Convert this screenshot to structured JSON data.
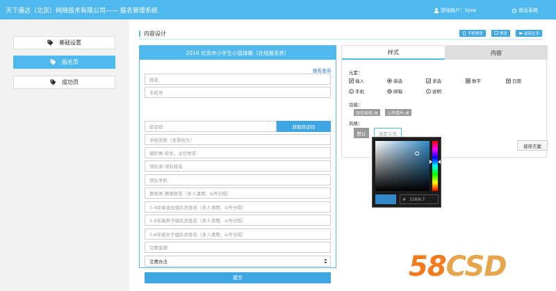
{
  "header": {
    "title": "天下遇达（北京）网络技术有限公司—— 报名管理系统",
    "user_label": "登陆账户：bjxw",
    "logout_label": "退出系统"
  },
  "sidebar": {
    "items": [
      {
        "label": "基础设置",
        "active": false
      },
      {
        "label": "报名页",
        "active": true
      },
      {
        "label": "成功页",
        "active": false
      }
    ]
  },
  "main": {
    "section_title": "内容设计",
    "top_buttons": [
      {
        "label": "手机预览",
        "icon": "phone-icon"
      },
      {
        "label": "预览",
        "icon": "monitor-icon"
      },
      {
        "label": "返回主页",
        "icon": "back-arrow-icon"
      }
    ]
  },
  "form": {
    "title": "2016 北京市小学生小篮球赛（在线报名表）",
    "query_link": "报名查询",
    "fields": [
      {
        "placeholder": "姓名"
      },
      {
        "placeholder": "手机号"
      },
      {
        "placeholder": "验证码"
      },
      {
        "placeholder": "学校名称（发票抬头）"
      },
      {
        "placeholder": "组织类-校长、主任姓名"
      },
      {
        "placeholder": "领队类-领队姓名"
      },
      {
        "placeholder": "领队手机"
      },
      {
        "placeholder": "教练类-教练姓名（多人请用、&号分隔）"
      },
      {
        "placeholder": "3-4年级混合组队员姓名（多人请用、&号分隔）"
      },
      {
        "placeholder": "5-6年级男子组队员姓名（多人请用、&号分隔）"
      },
      {
        "placeholder": "5-6年级女子组队员姓名（多人请用、&号分隔）"
      },
      {
        "placeholder": "交费金额"
      }
    ],
    "verify_button": "获取验证码",
    "select_value": "交费办法",
    "submit_label": "提交"
  },
  "settings": {
    "tabs": [
      "样式",
      "内容"
    ],
    "active_tab": "样式",
    "elements_label": "元素：",
    "elements": [
      {
        "label": "输入",
        "icon": "pencil-icon"
      },
      {
        "label": "单选",
        "icon": "radio-icon"
      },
      {
        "label": "多选",
        "icon": "checkbox-icon"
      },
      {
        "label": "数字",
        "icon": "number-icon"
      },
      {
        "label": "日期",
        "icon": "calendar-icon"
      },
      {
        "label": "手机",
        "icon": "phone-icon"
      },
      {
        "label": "邮箱",
        "icon": "at-icon"
      },
      {
        "label": "说明",
        "icon": "info-icon"
      }
    ],
    "functions_label": "功能：",
    "functions": [
      "短信校验-关",
      "上传照片-关"
    ],
    "style_label": "风格：",
    "style_default": "默认",
    "style_custom": "自定义色",
    "save_label": "保存方案"
  },
  "color_picker": {
    "hash": "#",
    "hex_value": "3289c7",
    "selected_color": "#3289c7"
  },
  "colors": {
    "accent": "#4fb8ec",
    "button": "#3ea7e2"
  },
  "watermark": {
    "part1": "58",
    "part2": "CSD"
  }
}
